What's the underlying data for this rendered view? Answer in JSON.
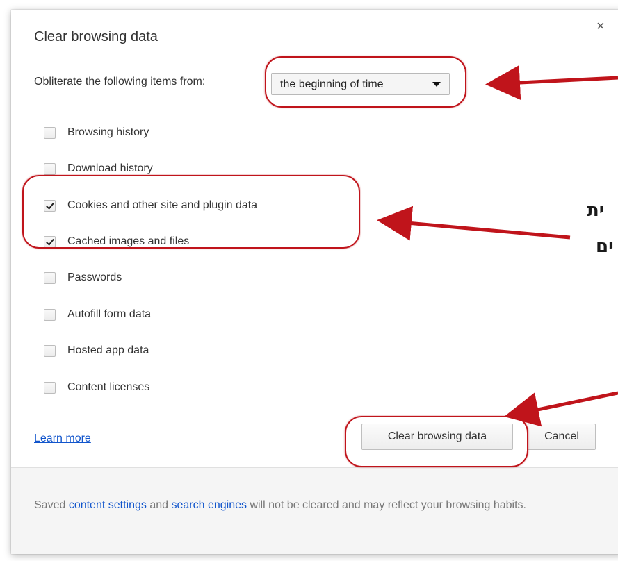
{
  "dialog": {
    "title": "Clear browsing data",
    "close_icon": "×"
  },
  "period": {
    "label": "Obliterate the following items from:",
    "selected": "the beginning of time"
  },
  "options": [
    {
      "label": "Browsing history",
      "checked": false
    },
    {
      "label": "Download history",
      "checked": false
    },
    {
      "label": "Cookies and other site and plugin data",
      "checked": true
    },
    {
      "label": "Cached images and files",
      "checked": true
    },
    {
      "label": "Passwords",
      "checked": false
    },
    {
      "label": "Autofill form data",
      "checked": false
    },
    {
      "label": "Hosted app data",
      "checked": false
    },
    {
      "label": "Content licenses",
      "checked": false
    }
  ],
  "actions": {
    "learn_more": "Learn more",
    "clear_button": "Clear browsing data",
    "cancel_button": "Cancel"
  },
  "footer": {
    "prefix": "Saved ",
    "link1": "content settings",
    "middle": " and ",
    "link2": "search engines",
    "suffix": " will not be cleared and may reflect your browsing habits."
  },
  "annotations": {
    "hebrew_line1": "ית",
    "hebrew_line2": "ים",
    "accent_color": "#c0141b"
  }
}
